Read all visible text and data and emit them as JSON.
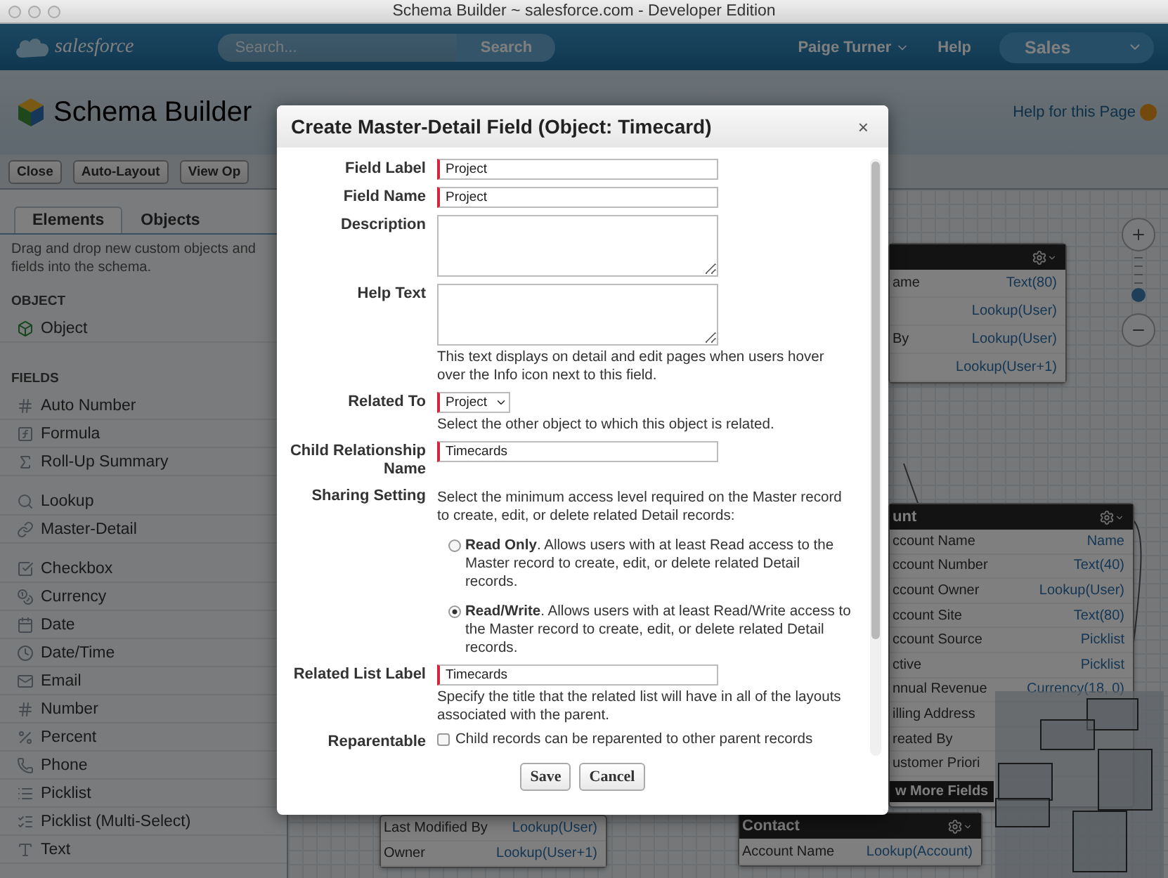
{
  "window": {
    "title": "Schema Builder ~ salesforce.com - Developer Edition"
  },
  "header": {
    "logo": "salesforce",
    "search": {
      "placeholder": "Search..."
    },
    "search_button": "Search",
    "user_menu": "Paige Turner",
    "help": "Help",
    "app_menu": "Sales"
  },
  "page": {
    "title": "Schema Builder",
    "help_link": "Help for this Page"
  },
  "toolbar": [
    "Close",
    "Auto-Layout",
    "View Op"
  ],
  "sidebar": {
    "tabs": [
      {
        "label": "Elements",
        "selected": true
      },
      {
        "label": "Objects",
        "selected": false
      }
    ],
    "hint": "Drag and drop new custom objects and fields into the schema.",
    "sections": [
      {
        "heading": "OBJECT",
        "groups": [
          [
            "Object"
          ]
        ]
      },
      {
        "heading": "FIELDS",
        "groups": [
          [
            "Auto Number",
            "Formula",
            "Roll-Up Summary"
          ],
          [
            "Lookup",
            "Master-Detail"
          ],
          [
            "Checkbox",
            "Currency",
            "Date",
            "Date/Time",
            "Email",
            "Number",
            "Percent",
            "Phone",
            "Picklist",
            "Picklist (Multi-Select)",
            "Text"
          ]
        ]
      }
    ]
  },
  "canvas": {
    "zoom": {
      "level": 0.15
    },
    "cards": [
      {
        "rows": [
          {
            "name": "ame",
            "type": "Text(80)"
          },
          {
            "type": "Lookup(User)"
          },
          {
            "name": "By",
            "type": "Lookup(User)"
          },
          {
            "type": "Lookup(User+1)"
          }
        ]
      },
      {
        "title": "unt",
        "rows": [
          {
            "name": "ccount Name",
            "type": "Name"
          },
          {
            "name": "ccount Number",
            "type": "Text(40)"
          },
          {
            "name": "ccount Owner",
            "type": "Lookup(User)"
          },
          {
            "name": "ccount Site",
            "type": "Text(80)"
          },
          {
            "name": "ccount Source",
            "type": "Picklist"
          },
          {
            "name": "ctive",
            "type": "Picklist"
          },
          {
            "name": "nnual Revenue",
            "type": "Currency(18, 0)"
          },
          {
            "name": "illing Address"
          },
          {
            "name": "reated By"
          },
          {
            "name": "ustomer Priori"
          }
        ],
        "more": "w More Fields"
      },
      {
        "rows": [
          {
            "name": "Last Modified By",
            "type": "Lookup(User)"
          },
          {
            "name": "Owner",
            "type": "Lookup(User+1)"
          }
        ]
      },
      {
        "title": "Contact",
        "rows": [
          {
            "name": "Account Name",
            "type": "Lookup(Account)"
          }
        ]
      }
    ]
  },
  "dialog": {
    "title": "Create Master-Detail Field (Object: Timecard)",
    "close": "×",
    "fields": [
      {
        "kind": "text",
        "label": "Field Label",
        "value": "Project",
        "required": true
      },
      {
        "kind": "text",
        "label": "Field Name",
        "value": "Project",
        "required": true
      },
      {
        "kind": "textarea",
        "label": "Description",
        "required": false
      },
      {
        "kind": "textarea",
        "label": "Help Text",
        "required": false,
        "help": "This text displays on detail and edit pages when users hover over the Info icon next to this field."
      },
      {
        "kind": "select",
        "label": "Related To",
        "value": "Project",
        "required": true,
        "help": "Select the other object to which this object is related."
      },
      {
        "kind": "text",
        "label": "Child Relationship Name",
        "value": "Timecards",
        "required": true
      },
      {
        "kind": "radio-group",
        "label": "Sharing Setting",
        "help": "Select the minimum access level required on the Master record to create, edit, or delete related Detail records:",
        "options": [
          {
            "text": "**Read Only**. Allows users with at least Read access to the Master record to create, edit, or delete related Detail records.",
            "selected": false
          },
          {
            "text": "**Read/Write**. Allows users with at least Read/Write access to the Master record to create, edit, or delete related Detail records.",
            "selected": true
          }
        ]
      },
      {
        "kind": "text",
        "label": "Related List Label",
        "value": "Timecards",
        "required": true,
        "help": "Specify the title that the related list will have in all of the layouts associated with the parent."
      },
      {
        "kind": "checkbox",
        "label": "Reparentable",
        "text": "Child records can be reparented to other parent records",
        "checked": false
      }
    ],
    "buttons": [
      "Save",
      "Cancel"
    ]
  }
}
